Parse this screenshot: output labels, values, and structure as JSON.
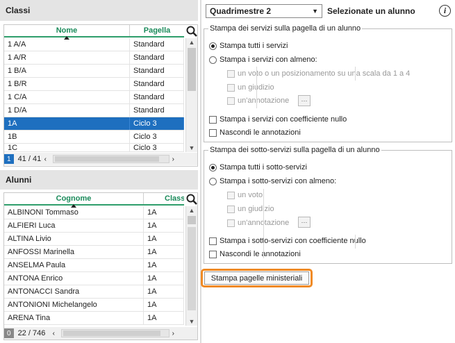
{
  "classi": {
    "title": "Classi",
    "col_nome": "Nome",
    "col_pagella": "Pagella",
    "rows": [
      {
        "nome": "1 A/A",
        "pagella": "Standard"
      },
      {
        "nome": "1 A/R",
        "pagella": "Standard"
      },
      {
        "nome": "1 B/A",
        "pagella": "Standard"
      },
      {
        "nome": "1 B/R",
        "pagella": "Standard"
      },
      {
        "nome": "1 C/A",
        "pagella": "Standard"
      },
      {
        "nome": "1 D/A",
        "pagella": "Standard"
      },
      {
        "nome": "1A",
        "pagella": "Ciclo 3"
      },
      {
        "nome": "1B",
        "pagella": "Ciclo 3"
      },
      {
        "nome": "1C",
        "pagella": "Ciclo 3"
      }
    ],
    "selected_badge": "1",
    "count": "41 / 41"
  },
  "alunni": {
    "title": "Alunni",
    "col_cognome": "Cognome",
    "col_classe": "Classe",
    "rows": [
      {
        "nome": "ALBINONI Tommaso",
        "classe": "1A"
      },
      {
        "nome": "ALFIERI Luca",
        "classe": "1A"
      },
      {
        "nome": "ALTINA Livio",
        "classe": "1A"
      },
      {
        "nome": "ANFOSSI Marinella",
        "classe": "1A"
      },
      {
        "nome": "ANSELMA Paula",
        "classe": "1A"
      },
      {
        "nome": "ANTONA Enrico",
        "classe": "1A"
      },
      {
        "nome": "ANTONACCI Sandra",
        "classe": "1A"
      },
      {
        "nome": "ANTONIONI Michelangelo",
        "classe": "1A"
      },
      {
        "nome": "ARENA Tina",
        "classe": "1A"
      }
    ],
    "selected_badge": "0",
    "count": "22 / 746"
  },
  "toolbar": {
    "period": "Quadrimestre 2",
    "select_student": "Selezionate un alunno",
    "info": "i"
  },
  "servizi": {
    "legend": "Stampa dei servizi sulla pagella di un alunno",
    "opt_all": "Stampa tutti i servizi",
    "opt_some": "Stampa i servizi con almeno:",
    "sub_voto": "un voto o un posizionamento su una scala da 1 a 4",
    "sub_giudizio": "un giudizio",
    "sub_annotazione": "un'annotazione",
    "coef_nullo": "Stampa i servizi con coefficiente nullo",
    "nascondi": "Nascondi le annotazioni"
  },
  "sottoservizi": {
    "legend": "Stampa dei sotto-servizi sulla pagella di un alunno",
    "opt_all": "Stampa tutti i sotto-servizi",
    "opt_some": "Stampa i sotto-servizi con almeno:",
    "sub_voto": "un voto",
    "sub_giudizio": "un giudizio",
    "sub_annotazione": "un'annotazione",
    "coef_nullo": "Stampa i sotto-servizi con coefficiente nullo",
    "nascondi": "Nascondi le annotazioni"
  },
  "print_button": "Stampa pagelle ministeriali",
  "dots_label": "···",
  "accent_green": "#2e9e6b",
  "selection_blue": "#1e6fbf",
  "highlight_orange": "#f08a24"
}
